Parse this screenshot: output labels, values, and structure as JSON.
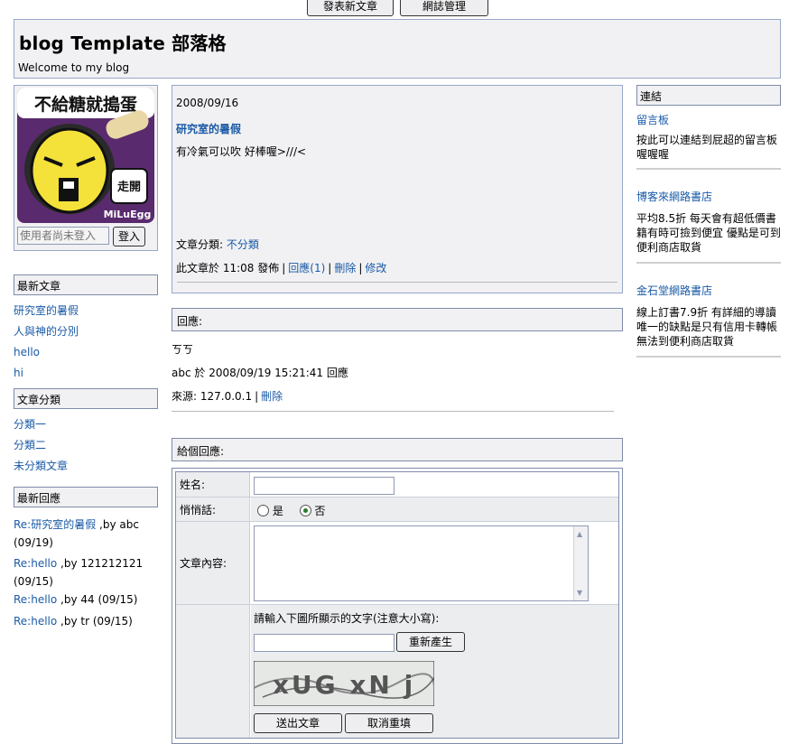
{
  "toolbar": {
    "new_post": "發表新文章",
    "blog_admin": "網誌管理"
  },
  "header": {
    "title": "blog Template 部落格",
    "welcome": "Welcome to my blog"
  },
  "avatar": {
    "image_text": "不給糖就搗蛋",
    "badge_text": "走開",
    "brand_text": "MiLuEgg"
  },
  "login": {
    "placeholder": "使用者尚未登入",
    "button": "登入"
  },
  "sidebar": {
    "latest_posts": {
      "heading": "最新文章",
      "items": [
        "研究室的暑假",
        "人與神的分別",
        "hello",
        "hi"
      ]
    },
    "categories": {
      "heading": "文章分類",
      "items": [
        "分類一",
        "分類二",
        "未分類文章"
      ]
    },
    "latest_replies": {
      "heading": "最新回應",
      "items": [
        {
          "link": "Re:研究室的暑假",
          "rest": " ,by abc (09/19)"
        },
        {
          "link": "Re:hello",
          "rest": " ,by 121212121 (09/15)"
        },
        {
          "link": "Re:hello",
          "rest": " ,by 44 (09/15)"
        },
        {
          "link": "Re:hello",
          "rest": " ,by tr (09/15)"
        }
      ]
    }
  },
  "post": {
    "date": "2008/09/16",
    "title": "研究室的暑假",
    "body": "有冷氣可以吹 好棒喔>///<",
    "category_label": "文章分類:",
    "category_value": "不分類",
    "posted_prefix": "此文章於 11:08 發佈",
    "reply_link": "回應(1)",
    "delete_link": "刪除",
    "edit_link": "修改"
  },
  "replies": {
    "heading": "回應:",
    "items": [
      {
        "content": "ㄎㄎ",
        "meta": "abc 於 2008/09/19 15:21:41 回應",
        "source": "來源: 127.0.0.1",
        "delete": "刪除"
      }
    ]
  },
  "reply_form": {
    "heading": "給個回應:",
    "name_label": "姓名:",
    "name_value": "",
    "whisper_label": "悄悄話:",
    "whisper_yes": "是",
    "whisper_no": "否",
    "whisper_selected": "否",
    "content_label": "文章內容:",
    "captcha_prompt": "請輸入下圖所顯示的文字(注意大小寫):",
    "captcha_value": "",
    "regenerate": "重新產生",
    "captcha_text": "xUG xN j",
    "submit": "送出文章",
    "reset": "取消重填"
  },
  "links": {
    "heading": "連結",
    "items": [
      {
        "title": "留言板",
        "desc": "按此可以連結到屁超的留言板喔喔喔"
      },
      {
        "title": "博客來網路書店",
        "desc": "平均8.5折 每天會有超低價書籍有時可撿到便宜 優點是可到便利商店取貨"
      },
      {
        "title": "金石堂網路書店",
        "desc": "線上訂書7.9折 有詳細的導讀 唯一的缺點是只有信用卡轉帳 無法到便利商店取貨"
      }
    ]
  }
}
